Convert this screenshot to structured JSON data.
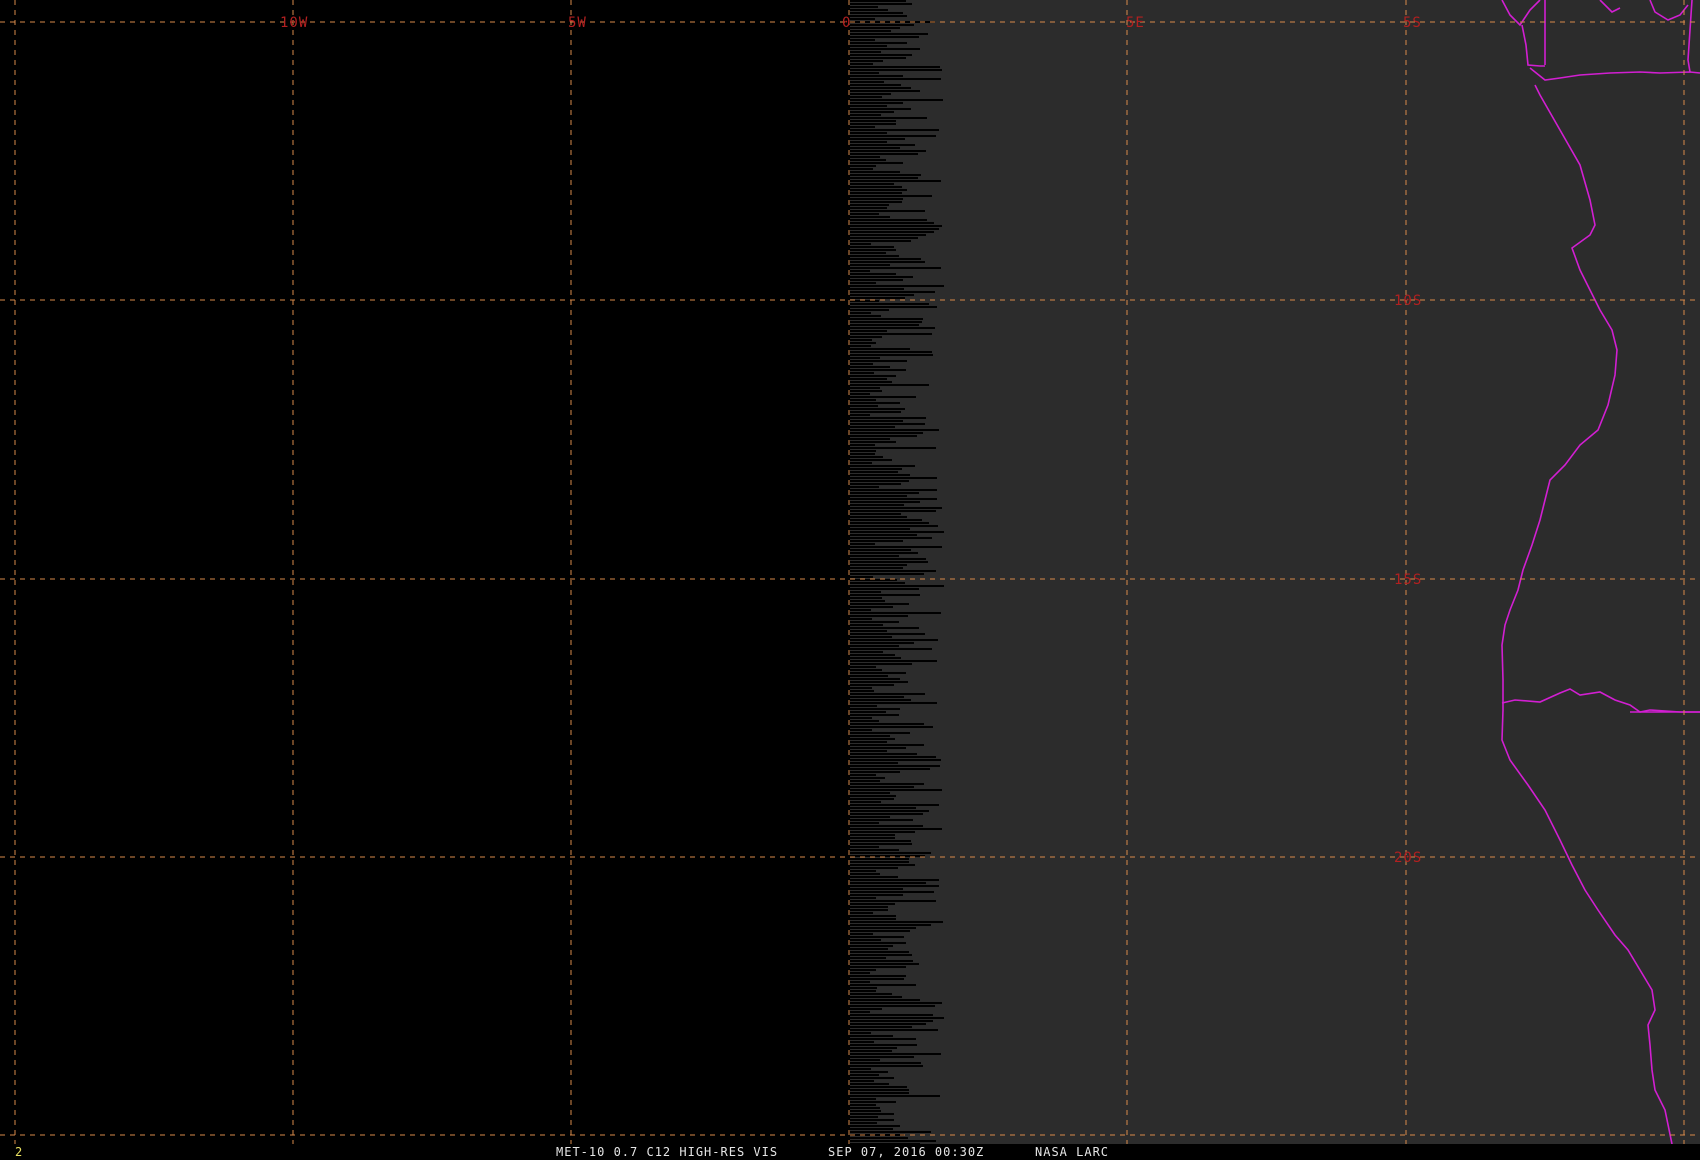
{
  "image": {
    "satellite": "MET-10",
    "channel": "0.7 C12 HIGH-RES VIS",
    "datetime": "SEP 07, 2016 00:30Z",
    "credit": "NASA LARC",
    "frame_number": "2"
  },
  "status_bar": {
    "product_text": "MET-10 0.7 C12 HIGH-RES VIS",
    "time_text": "SEP 07, 2016 00:30Z",
    "credit_text": "NASA LARC"
  },
  "grid": {
    "longitude_labels": [
      "10W",
      "5W",
      "0",
      "5E",
      "5S"
    ],
    "latitude_labels": [
      "10S",
      "15S",
      "20S"
    ]
  },
  "colors": {
    "background": "#000000",
    "earth_disk": "#2c2c2c",
    "grid_line": "#d98a4a",
    "grid_label": "#b22020",
    "coastline": "#d21fd2",
    "status_text": "#e6e6e6",
    "frame_number": "#e8e060"
  }
}
